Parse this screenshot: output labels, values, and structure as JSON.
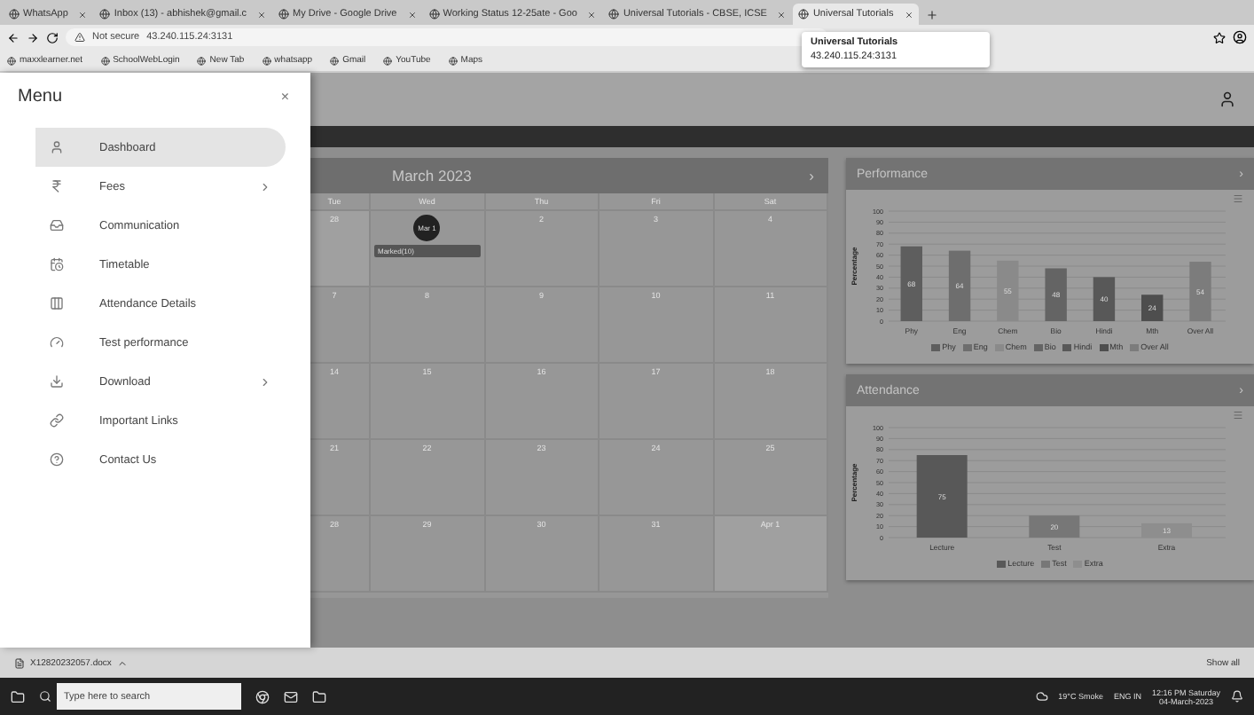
{
  "browser": {
    "tabs": [
      {
        "label": "WhatsApp",
        "selected": false
      },
      {
        "label": "Inbox (13) - abhishek@gmail.c",
        "selected": false
      },
      {
        "label": "My Drive - Google Drive",
        "selected": false
      },
      {
        "label": "Working Status 12-25ate - Goo",
        "selected": false
      },
      {
        "label": "Universal Tutorials - CBSE, ICSE",
        "selected": false
      },
      {
        "label": "Universal Tutorials",
        "selected": true
      }
    ],
    "security": "Not secure",
    "address": "43.240.115.24:3131",
    "bookmarks": [
      "maxxlearner.net",
      "SchoolWebLogin",
      "New Tab",
      "whatsapp",
      "Gmail",
      "YouTube",
      "Maps"
    ],
    "tooltip": {
      "title": "Universal Tutorials",
      "url": "43.240.115.24:3131"
    }
  },
  "menu": {
    "title": "Menu",
    "close": "×",
    "items": [
      {
        "label": "Dashboard",
        "selected": true,
        "submenu": false
      },
      {
        "label": "Fees",
        "selected": false,
        "submenu": true
      },
      {
        "label": "Communication",
        "selected": false,
        "submenu": false
      },
      {
        "label": "Timetable",
        "selected": false,
        "submenu": false
      },
      {
        "label": "Attendance Details",
        "selected": false,
        "submenu": false
      },
      {
        "label": "Test performance",
        "selected": false,
        "submenu": false
      },
      {
        "label": "Download",
        "selected": false,
        "submenu": true
      },
      {
        "label": "Important Links",
        "selected": false,
        "submenu": false
      },
      {
        "label": "Contact Us",
        "selected": false,
        "submenu": false
      }
    ]
  },
  "calendar": {
    "title": "March 2023",
    "next": "›",
    "weekdays": [
      "Tue",
      "Wed",
      "Thu",
      "Fri",
      "Sat"
    ],
    "weeks": [
      [
        {
          "day": "28",
          "other": true,
          "today": false
        },
        {
          "day": "Mar 1",
          "other": false,
          "today": true,
          "event": "Marked(10)"
        },
        {
          "day": "2",
          "other": false,
          "today": false
        },
        {
          "day": "3",
          "other": false,
          "today": false
        },
        {
          "day": "4",
          "other": false,
          "today": false
        }
      ],
      [
        {
          "day": "7",
          "other": false,
          "today": false
        },
        {
          "day": "8",
          "other": false,
          "today": false
        },
        {
          "day": "9",
          "other": false,
          "today": false
        },
        {
          "day": "10",
          "other": false,
          "today": false
        },
        {
          "day": "11",
          "other": false,
          "today": false
        }
      ],
      [
        {
          "day": "14",
          "other": false,
          "today": false
        },
        {
          "day": "15",
          "other": false,
          "today": false
        },
        {
          "day": "16",
          "other": false,
          "today": false
        },
        {
          "day": "17",
          "other": false,
          "today": false
        },
        {
          "day": "18",
          "other": false,
          "today": false
        }
      ],
      [
        {
          "day": "21",
          "other": false,
          "today": false
        },
        {
          "day": "22",
          "other": false,
          "today": false
        },
        {
          "day": "23",
          "other": false,
          "today": false
        },
        {
          "day": "24",
          "other": false,
          "today": false
        },
        {
          "day": "25",
          "other": false,
          "today": false
        }
      ],
      [
        {
          "day": "28",
          "other": false,
          "today": false
        },
        {
          "day": "29",
          "other": false,
          "today": false
        },
        {
          "day": "30",
          "other": false,
          "today": false
        },
        {
          "day": "31",
          "other": false,
          "today": false
        },
        {
          "day": "Apr 1",
          "other": true,
          "today": false
        }
      ]
    ]
  },
  "cards": [
    {
      "title": "Performance",
      "next": "›",
      "chart_data": {
        "type": "bar",
        "ylabel": "Percentage",
        "categories": [
          "Phy",
          "Eng",
          "Chem",
          "Bio",
          "Hindi",
          "Mth",
          "Over All"
        ],
        "values": [
          68,
          64,
          55,
          48,
          40,
          24,
          54
        ],
        "ylim": [
          0,
          100
        ],
        "yticks": [
          0,
          10,
          20,
          30,
          40,
          50,
          60,
          70,
          80,
          90,
          100
        ],
        "data_labels": true,
        "grid": true
      },
      "legend": [
        {
          "label": "Phy",
          "color": "#5e5e5e"
        },
        {
          "label": "Eng",
          "color": "#6e6e6e"
        },
        {
          "label": "Chem",
          "color": "#8a8a8a"
        },
        {
          "label": "Bio",
          "color": "#646464"
        },
        {
          "label": "Hindi",
          "color": "#585858"
        },
        {
          "label": "Mth",
          "color": "#4e4e4e"
        },
        {
          "label": "Over All",
          "color": "#7c7c7c"
        }
      ]
    },
    {
      "title": "Attendance",
      "next": "›",
      "chart_data": {
        "type": "bar",
        "ylabel": "Percentage",
        "categories": [
          "Lecture",
          "Test",
          "Extra"
        ],
        "values": [
          75,
          20,
          13
        ],
        "ylim": [
          0,
          100
        ],
        "yticks": [
          0,
          10,
          20,
          30,
          40,
          50,
          60,
          70,
          80,
          90,
          100
        ],
        "data_labels": true,
        "grid": true
      },
      "legend": [
        {
          "label": "Lecture",
          "color": "#585858"
        },
        {
          "label": "Test",
          "color": "#777777"
        },
        {
          "label": "Extra",
          "color": "#8e8e8e"
        }
      ]
    }
  ],
  "download_bar": {
    "file": "X12820232057.docx",
    "show_all": "Show all"
  },
  "taskbar": {
    "search": {
      "placeholder": "Type here to search"
    },
    "weather": "19°C Smoke",
    "lang": "ENG IN",
    "time": "12:16 PM Saturday",
    "date": "04-March-2023"
  }
}
